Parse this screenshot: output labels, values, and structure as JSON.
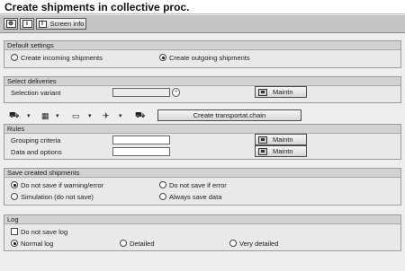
{
  "window": {
    "title": "Create shipments in collective proc."
  },
  "toolbar": {
    "screen_info_label": "Screen info"
  },
  "default_settings": {
    "heading": "Default settings",
    "incoming_label": "Create incoming shipments",
    "outgoing_label": "Create outgoing shipments",
    "selected": "outgoing"
  },
  "select_deliveries": {
    "heading": "Select deliveries",
    "selection_variant_label": "Selection variant",
    "selection_variant_value": "",
    "maintain_label": "Maintn"
  },
  "actions": {
    "create_chain_label": "Create transportat.chain"
  },
  "rules": {
    "heading": "Rules",
    "grouping_label": "Grouping criteria",
    "grouping_value": "",
    "data_options_label": "Data and options",
    "data_options_value": "",
    "maintain_label": "Maintn"
  },
  "save_created": {
    "heading": "Save created shipments",
    "opt_warning": "Do not save if warning/error",
    "opt_error": "Do not save if error",
    "opt_simulation": "Simulation (do not save)",
    "opt_always": "Always save data",
    "selected": "warning"
  },
  "log": {
    "heading": "Log",
    "do_not_save_label": "Do not save log",
    "do_not_save_checked": false,
    "opt_normal": "Normal log",
    "opt_detailed": "Detailed",
    "opt_very_detailed": "Very detailed",
    "selected": "normal"
  },
  "icons": {
    "toolbar_execute": "execute-icon",
    "toolbar_info": "info-icon",
    "truck": "truck-icon",
    "dropdown": "dropdown-arrow-icon",
    "matchcode": "matchcode-icon"
  }
}
